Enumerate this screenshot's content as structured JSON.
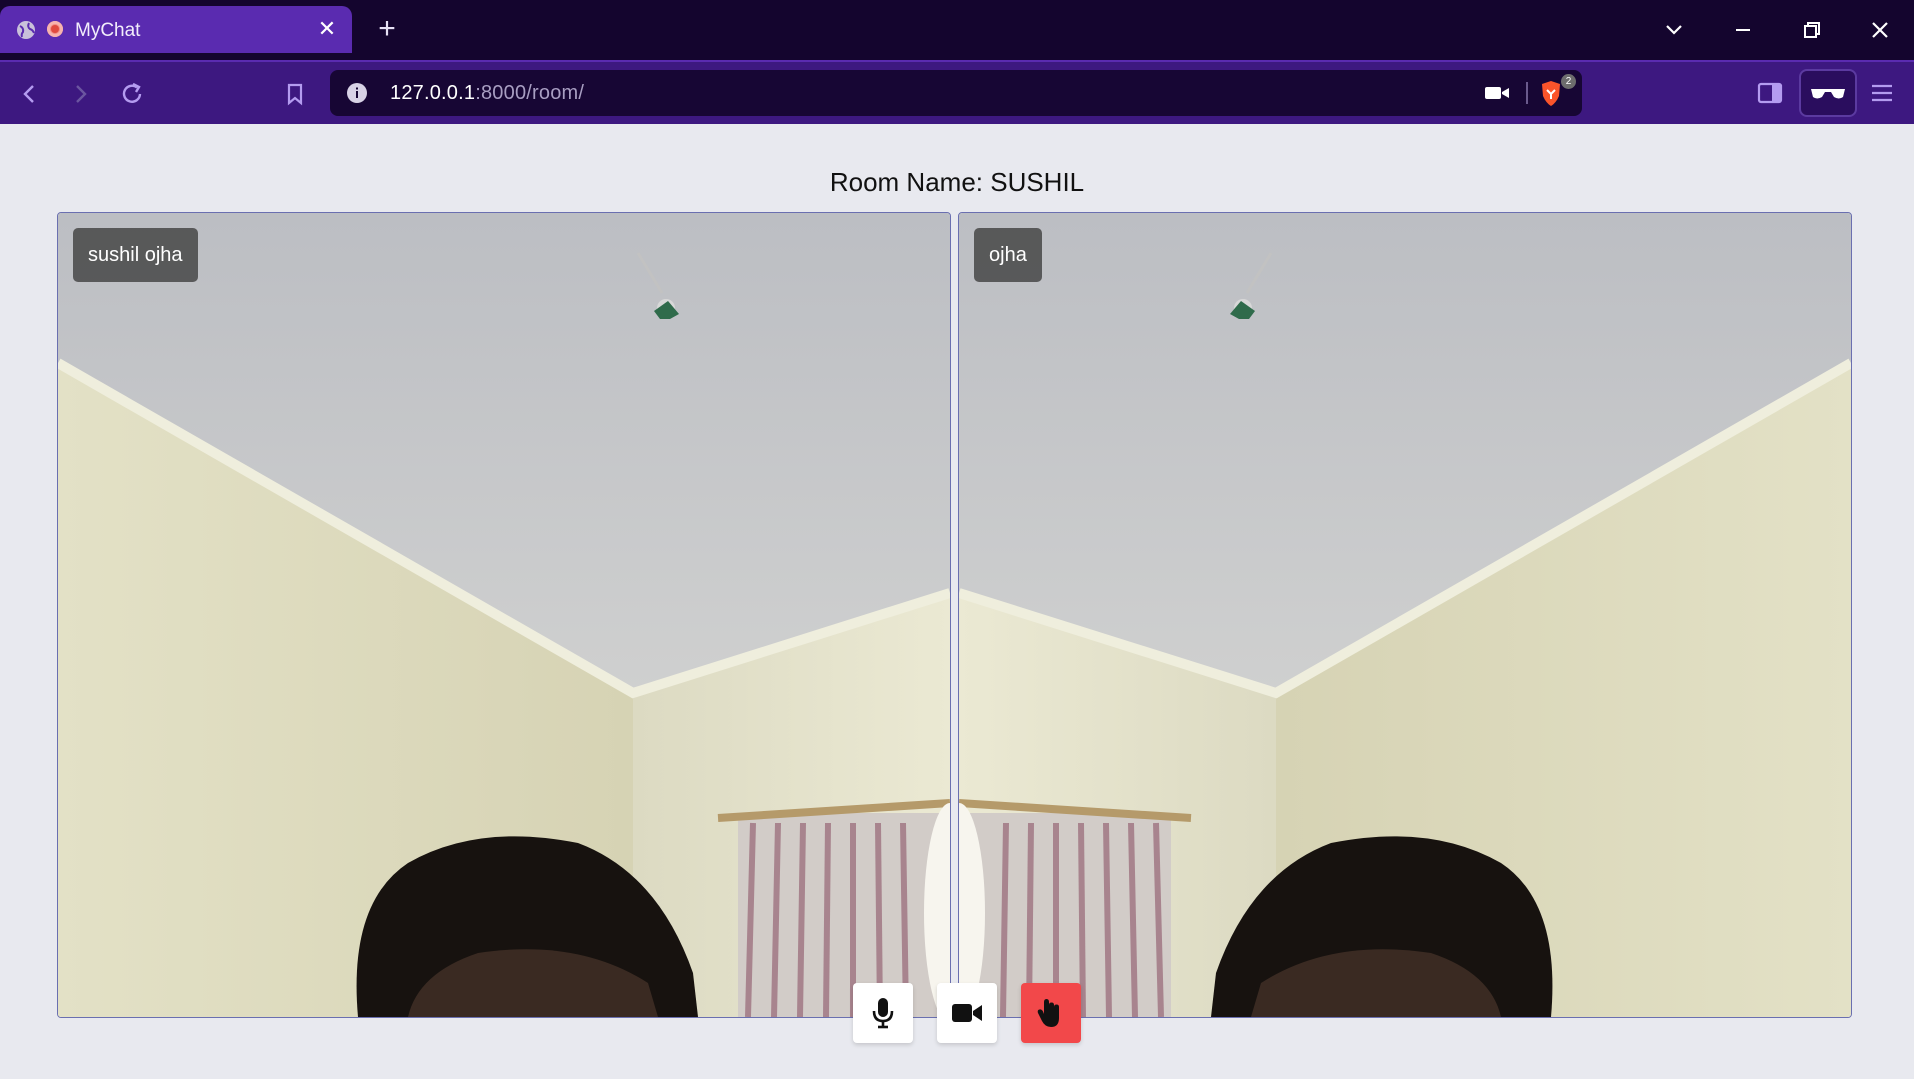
{
  "browser": {
    "tab": {
      "title": "MyChat",
      "close_glyph": "✕"
    },
    "new_tab_glyph": "+",
    "url": {
      "host": "127.0.0.1",
      "rest": ":8000/room/"
    },
    "shields_badge": "2"
  },
  "room": {
    "label": "Room Name: SUSHIL"
  },
  "participants": [
    {
      "name": "sushil ojha"
    },
    {
      "name": "ojha"
    }
  ],
  "controls": {
    "mic": {
      "icon": "microphone-icon"
    },
    "camera": {
      "icon": "video-camera-icon"
    },
    "leave": {
      "icon": "hand-icon",
      "color": "#f2484a"
    }
  },
  "colors": {
    "tabbar": "#14052e",
    "toolbar": "#3d1880",
    "active_tab": "#5a2bb0",
    "page_bg": "#e8e9ef"
  }
}
